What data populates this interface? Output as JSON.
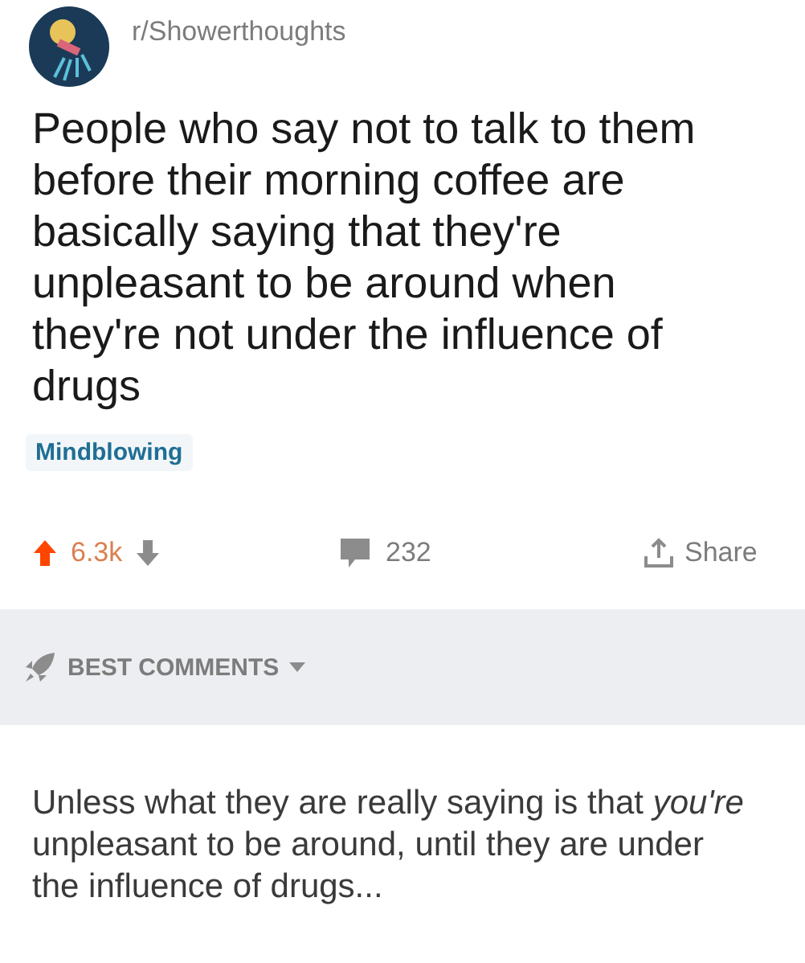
{
  "post": {
    "subreddit": "r/Showerthoughts",
    "title": "People who say not to talk to them before their morning coffee are basically saying that they're unpleasant to be around when they're not under the influence of drugs",
    "flair": "Mindblowing"
  },
  "actions": {
    "upvoted": true,
    "score": "6.3k",
    "comments": "232",
    "share": "Share"
  },
  "sort": {
    "label": "BEST COMMENTS"
  },
  "comments": [
    {
      "text": "Unless what they are really saying is that *you're* unpleasant to be around, until they are under the influence of drugs..."
    }
  ]
}
